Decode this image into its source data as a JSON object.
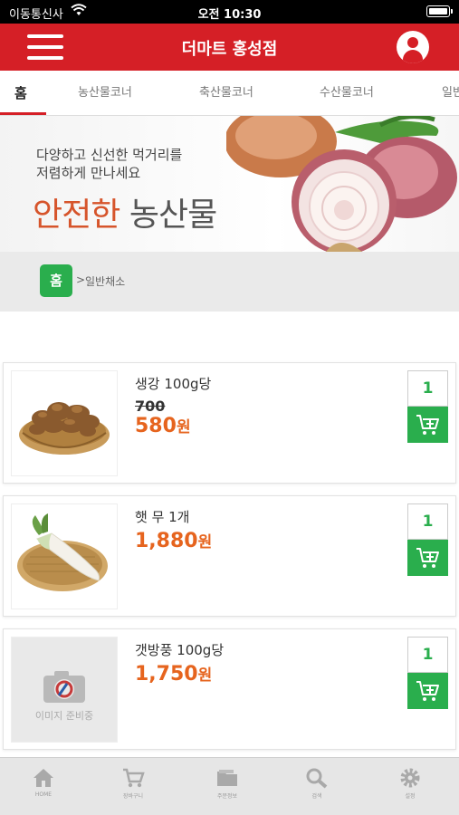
{
  "status_bar": {
    "carrier": "이동통신사",
    "time": "오전 10:30"
  },
  "header": {
    "title": "더마트 홍성점",
    "menu_icon": "hamburger-menu-icon",
    "user_icon": "user-profile-icon"
  },
  "tabs": [
    {
      "label": "홈",
      "active": true
    },
    {
      "label": "농산물코너"
    },
    {
      "label": "축산물코너"
    },
    {
      "label": "수산물코너"
    },
    {
      "label": "일반"
    }
  ],
  "banner": {
    "line1": "다양하고 신선한 먹거리를",
    "line2": "저렴하게 만나세요",
    "headline_accent": "안전한",
    "headline_main": "농산물"
  },
  "breadcrumb": {
    "home": "홈",
    "separator": ">",
    "current": "일반채소"
  },
  "products": [
    {
      "name": "생강 100g당",
      "original_price": "700",
      "price": "580",
      "currency": "원",
      "quantity": "1",
      "image": "ginger-basket"
    },
    {
      "name": "햇 무 1개",
      "original_price": "",
      "price": "1,880",
      "currency": "원",
      "quantity": "1",
      "image": "radish-basket"
    },
    {
      "name": "갯방풍 100g당",
      "original_price": "",
      "price": "1,750",
      "currency": "원",
      "quantity": "1",
      "image": "placeholder",
      "placeholder_text": "이미지 준비중"
    }
  ],
  "bottom_nav": [
    {
      "label": "HOME",
      "icon": "home-icon"
    },
    {
      "label": "장바구니",
      "icon": "cart-icon"
    },
    {
      "label": "주문정보",
      "icon": "folder-icon"
    },
    {
      "label": "검색",
      "icon": "search-icon"
    },
    {
      "label": "설정",
      "icon": "gear-icon"
    }
  ],
  "colors": {
    "brand_red": "#d51f26",
    "accent_green": "#2aae4d",
    "price_orange": "#e6641e"
  }
}
